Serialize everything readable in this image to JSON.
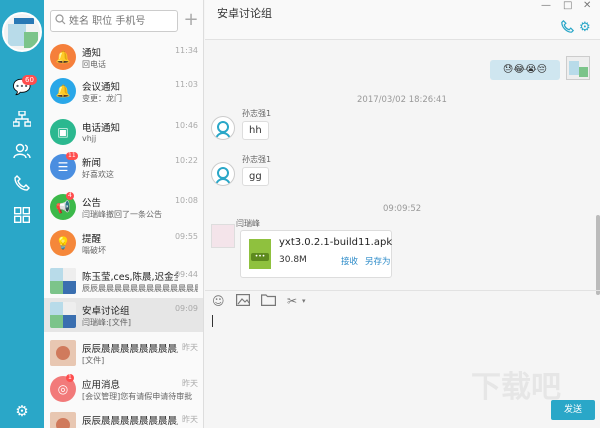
{
  "search": {
    "placeholder": "姓名 职位 手机号"
  },
  "rail": {
    "badge": "60"
  },
  "conversations": [
    {
      "title": "通知",
      "preview": "回电话",
      "time": "11:34",
      "color": "#f57f3b",
      "icon": "bell-icon"
    },
    {
      "title": "会议通知",
      "preview": "变更：龙门",
      "time": "11:03",
      "color": "#2aa7e8",
      "icon": "bell-icon"
    },
    {
      "title": "电话通知",
      "preview": "vhjj",
      "time": "10:46",
      "color": "#2bb88f",
      "icon": "monitor-icon"
    },
    {
      "title": "新闻",
      "preview": "好喜欢这",
      "time": "10:22",
      "color": "#4a8ee0",
      "icon": "news-icon",
      "badge": "11"
    },
    {
      "title": "公告",
      "preview": "闫瑞峰撤回了一条公告",
      "time": "10:08",
      "color": "#3cb94a",
      "icon": "megaphone-icon",
      "badge": "4"
    },
    {
      "title": "提醒",
      "preview": "嗡破坏",
      "time": "09:55",
      "color": "#f5873a",
      "icon": "bulb-icon"
    },
    {
      "title": "陈玉莹,ces,陈晨,迟金全,...",
      "preview": "辰辰晨晨晨晨晨晨晨晨晨晨晨晨晨v...",
      "time": "09:44",
      "icon": "group-avatar"
    },
    {
      "title": "安卓讨论组",
      "preview": "闫瑞峰:[文件]",
      "time": "09:09",
      "icon": "group-avatar",
      "selected": true
    },
    {
      "title": "辰辰晨晨晨晨晨晨晨晨晨晨晨...",
      "preview": "[文件]",
      "time": "昨天",
      "icon": "photo-avatar"
    },
    {
      "title": "应用消息",
      "preview": "[会议管理]您有请假申请待审批",
      "time": "昨天",
      "color": "#f27a7a",
      "icon": "app-icon",
      "badge": "1"
    },
    {
      "title": "辰辰晨晨晨晨晨晨晨晨晨晨晨...",
      "preview": "",
      "time": "昨天",
      "icon": "photo-avatar"
    }
  ],
  "chat": {
    "title": "安卓讨论组",
    "window_controls": {
      "min": "—",
      "max": "□",
      "close": "✕"
    },
    "my_message": "😓😂😭😔",
    "timestamp1": "2017/03/02 18:26:41",
    "messages": [
      {
        "sender": "孙志强1",
        "text": "hh"
      },
      {
        "sender": "孙志强1",
        "text": "gg"
      }
    ],
    "timestamp2": "09:09:52",
    "file_message": {
      "sender": "闫瑞峰",
      "file_name": "yxt3.0.2.1-build11.apk",
      "file_size": "30.8M",
      "receive": "接收",
      "save_as": "另存为"
    },
    "send_label": "发送",
    "watermark": "下载吧"
  }
}
